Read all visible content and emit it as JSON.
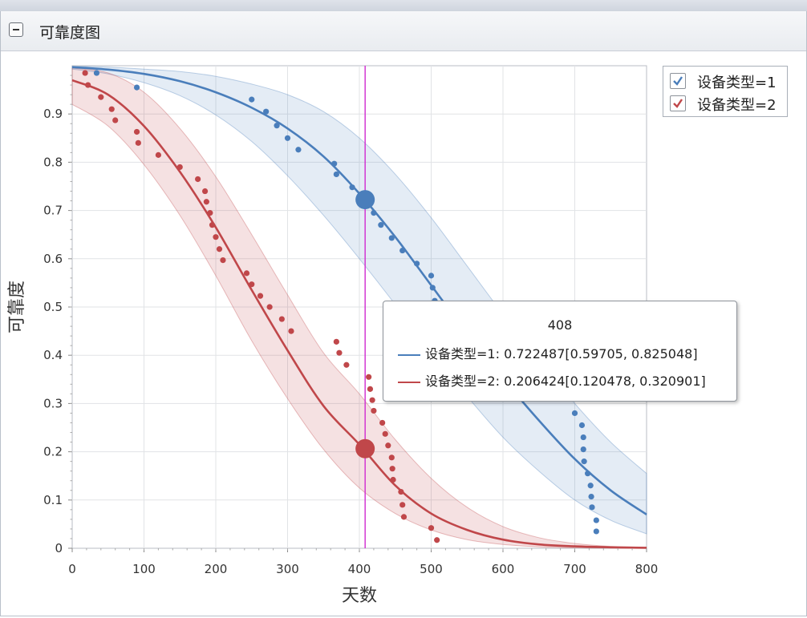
{
  "panel": {
    "title": "可靠度图"
  },
  "colors": {
    "series1": "#4a7ebb",
    "series2": "#c0474a",
    "cursor": "#d02ad0"
  },
  "legend": {
    "items": [
      {
        "label": "设备类型=1",
        "checked": true
      },
      {
        "label": "设备类型=2",
        "checked": true
      }
    ]
  },
  "tooltip": {
    "title": "408",
    "rows": [
      {
        "text": "设备类型=1: 0.722487[0.59705, 0.825048]"
      },
      {
        "text": "设备类型=2: 0.206424[0.120478, 0.320901]"
      }
    ]
  },
  "chart_data": {
    "type": "line",
    "xlabel": "天数",
    "ylabel": "可靠度",
    "xlim": [
      0,
      800
    ],
    "ylim": [
      0,
      1
    ],
    "xticks": [
      0,
      100,
      200,
      300,
      400,
      500,
      600,
      700,
      800
    ],
    "yticks": [
      0,
      0.1,
      0.2,
      0.3,
      0.4,
      0.5,
      0.6,
      0.7,
      0.8,
      0.9
    ],
    "ytick_labels": [
      "0",
      "0.1",
      "0.2",
      "0.3",
      "0.4",
      "0.5",
      "0.6",
      "0.7",
      "0.8",
      "0.9"
    ],
    "grid": true,
    "legend_position": "top-right",
    "cursor_x": 408,
    "series": [
      {
        "name": "设备类型=1",
        "curve_x": [
          0,
          50,
          100,
          150,
          200,
          250,
          300,
          350,
          400,
          450,
          500,
          550,
          600,
          650,
          700,
          750,
          800
        ],
        "curve": [
          0.997,
          0.992,
          0.983,
          0.968,
          0.945,
          0.913,
          0.87,
          0.812,
          0.735,
          0.645,
          0.545,
          0.445,
          0.352,
          0.265,
          0.185,
          0.12,
          0.07
        ],
        "band_low": [
          0.993,
          0.983,
          0.965,
          0.938,
          0.898,
          0.843,
          0.772,
          0.69,
          0.6,
          0.505,
          0.405,
          0.315,
          0.23,
          0.16,
          0.1,
          0.058,
          0.03
        ],
        "band_high": [
          0.999,
          0.997,
          0.993,
          0.988,
          0.978,
          0.962,
          0.94,
          0.905,
          0.85,
          0.775,
          0.685,
          0.585,
          0.485,
          0.39,
          0.3,
          0.22,
          0.155
        ],
        "marker": {
          "x": 408,
          "y": 0.722487
        },
        "points": [
          [
            34,
            0.985
          ],
          [
            90,
            0.955
          ],
          [
            250,
            0.93
          ],
          [
            270,
            0.905
          ],
          [
            285,
            0.876
          ],
          [
            300,
            0.85
          ],
          [
            315,
            0.826
          ],
          [
            365,
            0.797
          ],
          [
            368,
            0.775
          ],
          [
            390,
            0.748
          ],
          [
            420,
            0.695
          ],
          [
            430,
            0.67
          ],
          [
            445,
            0.643
          ],
          [
            460,
            0.617
          ],
          [
            480,
            0.59
          ],
          [
            500,
            0.565
          ],
          [
            502,
            0.54
          ],
          [
            505,
            0.513
          ],
          [
            700,
            0.28
          ],
          [
            710,
            0.255
          ],
          [
            712,
            0.23
          ],
          [
            712,
            0.205
          ],
          [
            713,
            0.18
          ],
          [
            718,
            0.155
          ],
          [
            722,
            0.13
          ],
          [
            723,
            0.107
          ],
          [
            724,
            0.085
          ],
          [
            730,
            0.058
          ],
          [
            730,
            0.035
          ]
        ]
      },
      {
        "name": "设备类型=2",
        "curve_x": [
          0,
          50,
          100,
          150,
          200,
          250,
          300,
          350,
          400,
          450,
          500,
          550,
          600,
          650,
          700,
          750,
          800
        ],
        "curve": [
          0.97,
          0.94,
          0.875,
          0.78,
          0.665,
          0.535,
          0.41,
          0.295,
          0.215,
          0.13,
          0.072,
          0.038,
          0.018,
          0.008,
          0.004,
          0.002,
          0.001
        ],
        "band_low": [
          0.92,
          0.875,
          0.795,
          0.69,
          0.565,
          0.43,
          0.31,
          0.205,
          0.125,
          0.072,
          0.038,
          0.018,
          0.008,
          0.003,
          0.001,
          0.0005,
          0.0002
        ],
        "band_high": [
          0.995,
          0.985,
          0.945,
          0.87,
          0.77,
          0.65,
          0.525,
          0.405,
          0.32,
          0.225,
          0.145,
          0.085,
          0.045,
          0.022,
          0.01,
          0.004,
          0.002
        ],
        "marker": {
          "x": 408,
          "y": 0.206424
        },
        "points": [
          [
            18,
            0.985
          ],
          [
            22,
            0.96
          ],
          [
            40,
            0.935
          ],
          [
            55,
            0.91
          ],
          [
            60,
            0.887
          ],
          [
            90,
            0.863
          ],
          [
            92,
            0.84
          ],
          [
            120,
            0.815
          ],
          [
            150,
            0.79
          ],
          [
            175,
            0.765
          ],
          [
            185,
            0.74
          ],
          [
            187,
            0.718
          ],
          [
            192,
            0.695
          ],
          [
            195,
            0.67
          ],
          [
            200,
            0.645
          ],
          [
            205,
            0.62
          ],
          [
            210,
            0.597
          ],
          [
            243,
            0.57
          ],
          [
            250,
            0.547
          ],
          [
            262,
            0.523
          ],
          [
            275,
            0.5
          ],
          [
            292,
            0.475
          ],
          [
            305,
            0.45
          ],
          [
            368,
            0.428
          ],
          [
            372,
            0.405
          ],
          [
            382,
            0.38
          ],
          [
            413,
            0.355
          ],
          [
            415,
            0.33
          ],
          [
            418,
            0.307
          ],
          [
            420,
            0.285
          ],
          [
            432,
            0.26
          ],
          [
            436,
            0.237
          ],
          [
            440,
            0.213
          ],
          [
            445,
            0.188
          ],
          [
            446,
            0.165
          ],
          [
            447,
            0.142
          ],
          [
            458,
            0.117
          ],
          [
            460,
            0.09
          ],
          [
            462,
            0.065
          ],
          [
            500,
            0.042
          ],
          [
            508,
            0.017
          ]
        ]
      }
    ]
  }
}
